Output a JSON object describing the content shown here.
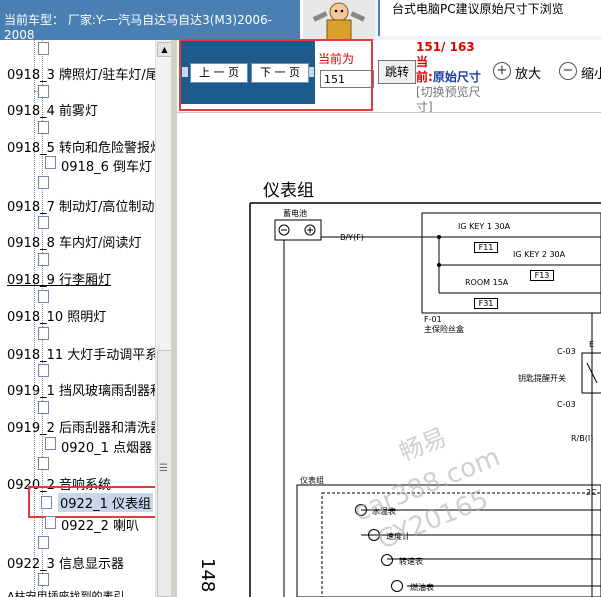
{
  "header": {
    "line1": "当前车型：  厂家:Y-一汽马自达马自达3(M3)2006-",
    "line2": "2008",
    "notice": "台式电脑PC建议原始尺寸下浏览"
  },
  "sidebar": {
    "items": [
      {
        "label": "0918_3 牌照灯/驻车灯/尾"
      },
      {
        "label": "0918_4 前雾灯"
      },
      {
        "label": "0918_5 转向和危险警报灯"
      },
      {
        "label": "0918_6 倒车灯"
      },
      {
        "label": "0918_7 制动灯/高位制动"
      },
      {
        "label": "0918_8 车内灯/阅读灯"
      },
      {
        "label": "0918_9 行李厢灯"
      },
      {
        "label": "0918_10 照明灯"
      },
      {
        "label": "0918_11 大灯手动调平系"
      },
      {
        "label": "0919_1 挡风玻璃雨刮器和"
      },
      {
        "label": "0919_2 后雨刮器和清洗器"
      },
      {
        "label": "0920_1 点烟器"
      },
      {
        "label": "0920_2 音响系统"
      },
      {
        "label": "0922_1 仪表组"
      },
      {
        "label": "0922_2 喇叭"
      },
      {
        "label": "0922_3 信息显示器"
      },
      {
        "label": "A柱安用插座找到的表引"
      }
    ],
    "scroll_grip": "☰"
  },
  "toolbar": {
    "prev_label": "上 一 页",
    "next_label": "下 一 页",
    "current_label": "当前为",
    "page_value": "151",
    "jump_label": "跳转",
    "page_info_count": "151/ 163",
    "page_info_tail": "当",
    "page_info_prefix": "前:",
    "page_info_size": "原始尺寸",
    "page_info_switch": "[切换预览尺寸]",
    "zoom_in_label": "放大",
    "zoom_out_label": "缩小",
    "zoom_in_symbol": "+",
    "zoom_out_symbol": "−"
  },
  "document": {
    "title": "仪表组",
    "page_number": "148",
    "labels": {
      "battery": "蓄电池",
      "wire_by": "B/Y(F)",
      "ig_key1": "IG KEY 1 30A",
      "f11": "F11",
      "ig_key2": "IG KEY 2 30A",
      "f13": "F13",
      "room": "ROOM 15A",
      "f31": "F31",
      "f01": "F-01",
      "main_fuse": "主保险丝盒",
      "c03a": "C-03",
      "e": "E",
      "key_switch": "钥匙提醒开关",
      "c03b": "C-03",
      "rb": "R/B(I)",
      "cluster": "仪表组",
      "water_temp": "水温表",
      "speedo": "速度计",
      "tacho": "转速表",
      "fuel": "燃油表",
      "c2": "2C"
    },
    "watermark": {
      "line1": "畅易",
      "line2": "car388.com",
      "line3": "CY20165"
    }
  },
  "colors": {
    "header_blue": "#4a7fb3",
    "nav_panel": "#1e5b8d",
    "highlight_red": "#e33b3b",
    "page_info_red": "#e00000",
    "page_info_blue": "#1a3ea8"
  }
}
